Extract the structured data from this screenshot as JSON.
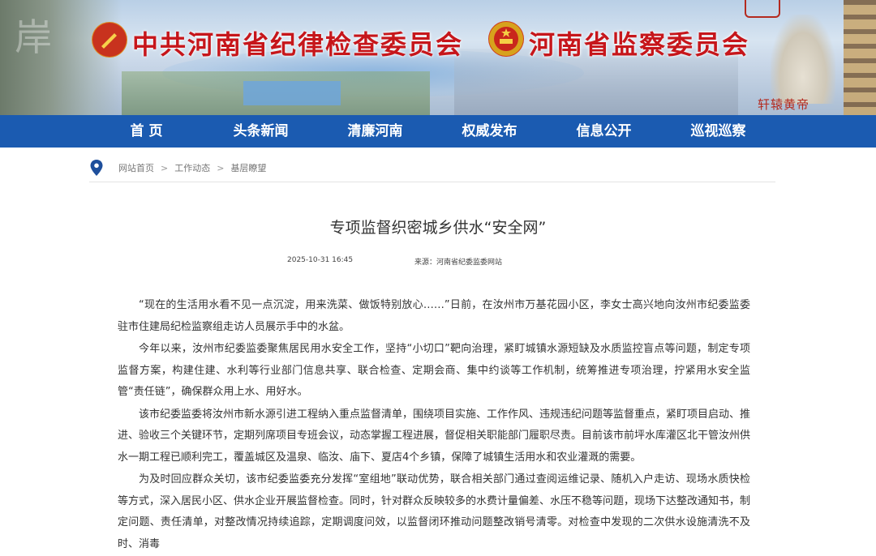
{
  "header": {
    "left_title": "中共河南省纪律检查委员会",
    "right_title": "河南省监察委员会",
    "rock_inscription": "岸",
    "calligraphy": "轩辕黄帝"
  },
  "nav": {
    "items": [
      "首 页",
      "头条新闻",
      "清廉河南",
      "权威发布",
      "信息公开",
      "巡视巡察"
    ]
  },
  "breadcrumb": {
    "items": [
      "网站首页",
      "工作动态",
      "基层瞭望"
    ],
    "separator": ">"
  },
  "article": {
    "title": "专项监督织密城乡供水“安全网”",
    "date": "2025-10-31 16:45",
    "source": "来源：河南省纪委监委网站",
    "paragraphs": [
      "“现在的生活用水看不见一点沉淀，用来洗菜、做饭特别放心……”日前，在汝州市万基花园小区，李女士高兴地向汝州市纪委监委驻市住建局纪检监察组走访人员展示手中的水盆。",
      "今年以来，汝州市纪委监委聚焦居民用水安全工作，坚持“小切口”靶向治理，紧盯城镇水源短缺及水质监控盲点等问题，制定专项监督方案，构建住建、水利等行业部门信息共享、联合检查、定期会商、集中约谈等工作机制，统筹推进专项治理，拧紧用水安全监管“责任链”，确保群众用上水、用好水。",
      "该市纪委监委将汝州市新水源引进工程纳入重点监督清单，围绕项目实施、工作作风、违规违纪问题等监督重点，紧盯项目启动、推进、验收三个关键环节，定期列席项目专班会议，动态掌握工程进展，督促相关职能部门履职尽责。目前该市前坪水库灌区北干管汝州供水一期工程已顺利完工，覆盖城区及温泉、临汝、庙下、夏店4个乡镇，保障了城镇生活用水和农业灌溉的需要。",
      "为及时回应群众关切，该市纪委监委充分发挥“室组地”联动优势，联合相关部门通过查阅运维记录、随机入户走访、现场水质快检等方式，深入居民小区、供水企业开展监督检查。同时，针对群众反映较多的水费计量偏差、水压不稳等问题，现场下达整改通知书，制定问题、责任清单，对整改情况持续追踪，定期调度问效，以监督闭环推动问题整改销号清零。对检查中发现的二次供水设施清洗不及时、消毒"
    ]
  },
  "colors": {
    "nav_bg": "#1b5bb1",
    "title_red": "#c6161b"
  }
}
